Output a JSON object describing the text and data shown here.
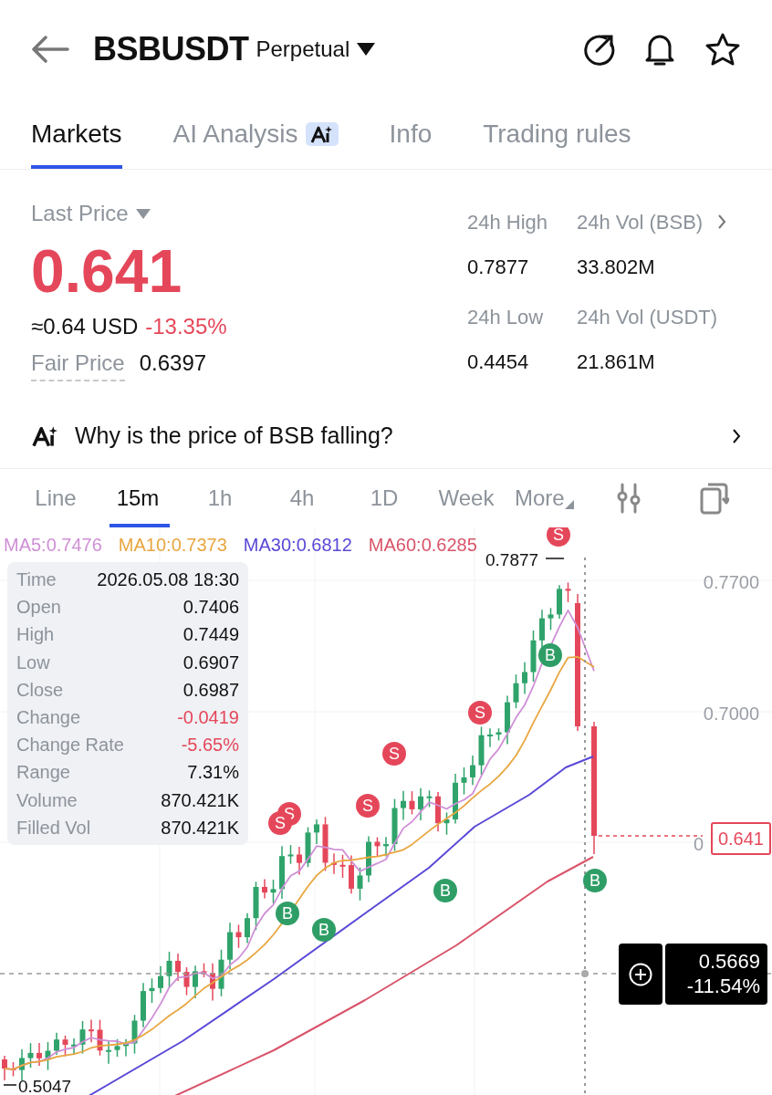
{
  "header": {
    "title": "BSBUSDT",
    "contract": "Perpetual"
  },
  "tabs": [
    {
      "label": "Markets",
      "selected": true,
      "kind": "text"
    },
    {
      "label": "AI Analysis",
      "selected": false,
      "kind": "ai"
    },
    {
      "label": "Info",
      "selected": false,
      "kind": "text"
    },
    {
      "label": "Trading rules",
      "selected": false,
      "kind": "text"
    }
  ],
  "price": {
    "label": "Last Price",
    "value": "0.641",
    "approx": "≈0.64 USD",
    "change": "-13.35%",
    "fair_label": "Fair Price",
    "fair_value": "0.6397"
  },
  "stats": [
    {
      "label": "24h High",
      "value": "0.7877",
      "link": false
    },
    {
      "label": "24h Vol (BSB)",
      "value": "33.802M",
      "link": true
    },
    {
      "label": "24h Low",
      "value": "0.4454",
      "link": false
    },
    {
      "label": "24h Vol  (USDT)",
      "value": "21.861M",
      "link": false
    }
  ],
  "ai_question": "Why is the price of BSB falling?",
  "intervals": [
    {
      "label": "Line",
      "selected": false
    },
    {
      "label": "15m",
      "selected": true
    },
    {
      "label": "1h",
      "selected": false
    },
    {
      "label": "4h",
      "selected": false
    },
    {
      "label": "1D",
      "selected": false
    },
    {
      "label": "Week",
      "selected": false
    },
    {
      "label": "More",
      "selected": false
    }
  ],
  "chart": {
    "ma": [
      {
        "label": "MA5:0.7476",
        "color": "#cf8fd6"
      },
      {
        "label": "MA10:0.7373",
        "color": "#e8a640"
      },
      {
        "label": "MA30:0.6812",
        "color": "#5848d6"
      },
      {
        "label": "MA60:0.6285",
        "color": "#d9546a"
      }
    ],
    "tooltip": [
      {
        "label": "Time",
        "value": "2026.05.08 18:30",
        "negative": false
      },
      {
        "label": "Open",
        "value": "0.7406",
        "negative": false
      },
      {
        "label": "High",
        "value": "0.7449",
        "negative": false
      },
      {
        "label": "Low",
        "value": "0.6907",
        "negative": false
      },
      {
        "label": "Close",
        "value": "0.6987",
        "negative": false
      },
      {
        "label": "Change",
        "value": "-0.0419",
        "negative": true
      },
      {
        "label": "Change Rate",
        "value": "-5.65%",
        "negative": true
      },
      {
        "label": "Range",
        "value": "7.31%",
        "negative": false
      },
      {
        "label": "Volume",
        "value": "870.421K",
        "negative": false
      },
      {
        "label": "Filled Vol",
        "value": "870.421K",
        "negative": false
      }
    ],
    "axis": [
      "0.7700",
      "0.7000",
      "0"
    ],
    "high_label": "0.7877",
    "low_label": "0.5047",
    "last_price": "0.641",
    "markers": [
      {
        "label": "S",
        "kind": "sell"
      },
      {
        "label": "S",
        "kind": "sell"
      },
      {
        "label": "S",
        "kind": "sell"
      },
      {
        "label": "S",
        "kind": "sell"
      },
      {
        "label": "S",
        "kind": "sell"
      },
      {
        "label": "S",
        "kind": "sell"
      },
      {
        "label": "B",
        "kind": "buy"
      },
      {
        "label": "B",
        "kind": "buy"
      },
      {
        "label": "B",
        "kind": "buy"
      },
      {
        "label": "B",
        "kind": "buy"
      },
      {
        "label": "B",
        "kind": "buy"
      }
    ],
    "crosshair": {
      "price": "0.5669",
      "change": "-11.54%"
    }
  }
}
